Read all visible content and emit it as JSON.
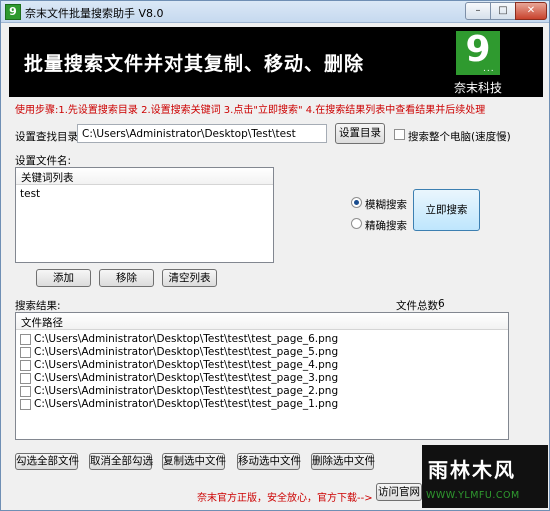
{
  "window": {
    "title": "奈末文件批量搜索助手 V8.0",
    "app_icon_glyph": "9",
    "controls": {
      "minimize": "–",
      "maximize": "□",
      "close": "✕"
    }
  },
  "banner": {
    "title": "批量搜索文件并对其复制、移动、删除",
    "logo_glyph": "9",
    "logo_dots": "...",
    "company": "奈末科技",
    "background_color": "#000000",
    "logo_color": "#2f9a2f"
  },
  "hint": "使用步骤:1.先设置搜索目录 2.设置搜索关键词 3.点击\"立即搜索\" 4.在搜索结果列表中查看结果并后续处理",
  "search_dir": {
    "label": "设置查找目录:",
    "value": "C:\\Users\\Administrator\\Desktop\\Test\\test",
    "button": "设置目录",
    "whole_pc_label": "搜索整个电脑(速度慢)",
    "whole_pc_checked": false
  },
  "keywords": {
    "label": "设置文件名:",
    "column_header": "关键词列表",
    "items": [
      "test"
    ],
    "add_button": "添加",
    "remove_button": "移除",
    "clear_button": "清空列表"
  },
  "search_mode": {
    "fuzzy_label": "模糊搜索",
    "exact_label": "精确搜索",
    "selected": "fuzzy",
    "search_button": "立即搜索"
  },
  "results": {
    "label": "搜索结果:",
    "total_label": "文件总数:",
    "total_value": "6",
    "column_header": "文件路径",
    "files": [
      "C:\\Users\\Administrator\\Desktop\\Test\\test\\test_page_6.png",
      "C:\\Users\\Administrator\\Desktop\\Test\\test\\test_page_5.png",
      "C:\\Users\\Administrator\\Desktop\\Test\\test\\test_page_4.png",
      "C:\\Users\\Administrator\\Desktop\\Test\\test\\test_page_3.png",
      "C:\\Users\\Administrator\\Desktop\\Test\\test\\test_page_2.png",
      "C:\\Users\\Administrator\\Desktop\\Test\\test\\test_page_1.png"
    ]
  },
  "actions": {
    "check_all": "勾选全部文件",
    "uncheck_all": "取消全部勾选",
    "copy_selected": "复制选中文件",
    "move_selected": "移动选中文件",
    "delete_selected": "删除选中文件"
  },
  "footer": {
    "notice": "奈末官方正版，安全放心，官方下载-->",
    "visit_button": "访问官网"
  },
  "watermark": {
    "top": "雨林木风",
    "bottom": "WWW.YLMFU.COM"
  }
}
